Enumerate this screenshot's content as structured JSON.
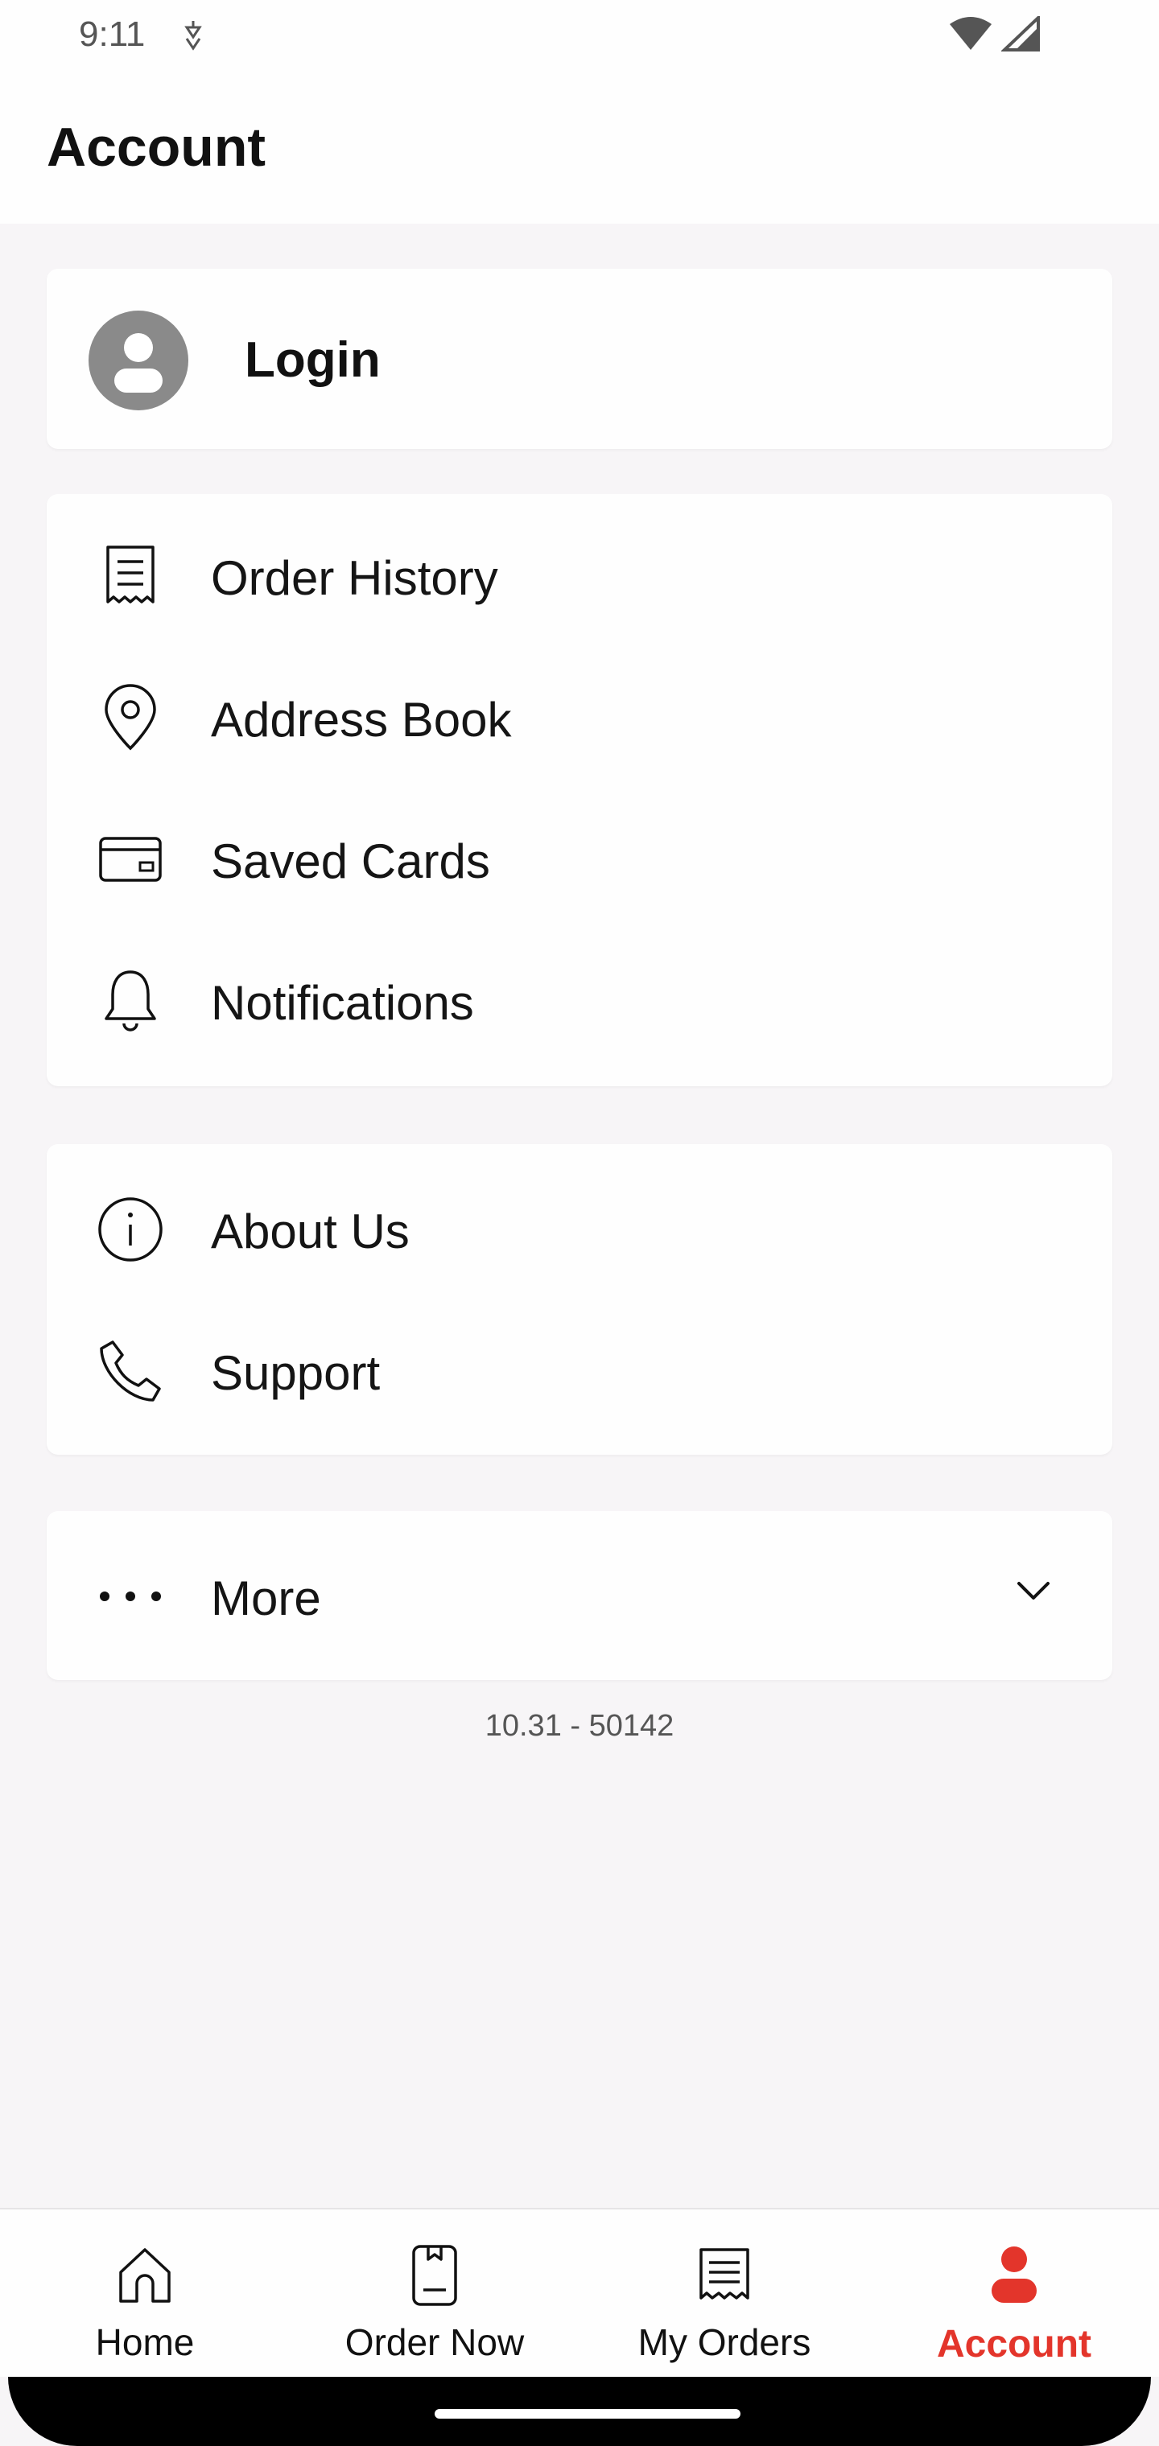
{
  "status_bar": {
    "time": "9:11"
  },
  "header": {
    "title": "Account"
  },
  "login": {
    "label": "Login"
  },
  "menu_group_1": [
    {
      "label": "Order History",
      "icon": "receipt-icon"
    },
    {
      "label": "Address Book",
      "icon": "location-pin-icon"
    },
    {
      "label": "Saved Cards",
      "icon": "credit-card-icon"
    },
    {
      "label": "Notifications",
      "icon": "bell-icon"
    }
  ],
  "menu_group_2": [
    {
      "label": "About Us",
      "icon": "info-icon"
    },
    {
      "label": "Support",
      "icon": "phone-icon"
    }
  ],
  "more": {
    "label": "More",
    "icon": "more-dots-icon"
  },
  "version": "10.31 - 50142",
  "bottom_nav": [
    {
      "label": "Home",
      "icon": "home-icon"
    },
    {
      "label": "Order Now",
      "icon": "order-now-icon"
    },
    {
      "label": "My Orders",
      "icon": "my-orders-icon"
    },
    {
      "label": "Account",
      "icon": "account-icon",
      "active": true
    }
  ],
  "colors": {
    "accent": "#e3352b",
    "background": "#f7f5f7",
    "card": "#fefefe"
  }
}
